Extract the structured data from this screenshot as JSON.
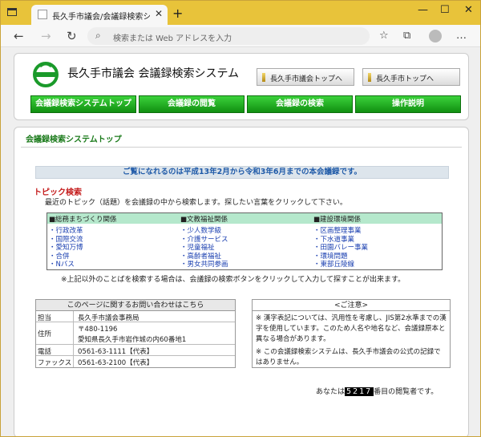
{
  "browser": {
    "tab_title": "長久手市議会/会議録検索システム",
    "tab_close": "✕",
    "new_tab": "+",
    "address_placeholder": "検索または Web アドレスを入力",
    "win_min": "—",
    "win_max": "☐",
    "win_close": "✕"
  },
  "header": {
    "site_title": "長久手市議会 会議録検索システム",
    "btn_council_top": "長久手市議会トップへ",
    "btn_city_top": "長久手市トップへ",
    "nav": [
      "会議録検索システムトップ",
      "会議録の閲覧",
      "会議録の検索",
      "操作説明"
    ]
  },
  "main": {
    "section_title": "会議録検索システムトップ",
    "banner": "ご覧になれるのは平成13年2月から令和3年6月までの本会議録です。",
    "topic_heading": "トピック検索",
    "topic_desc": "最近のトピック（話題）を会議録の中から検索します。探したい言葉をクリックして下さい。",
    "categories": [
      {
        "name": "■総務まちづくり関係",
        "items": [
          "・行政改革",
          "・国際交流",
          "・愛知万博",
          "・合併",
          "・Nバス"
        ]
      },
      {
        "name": "■文教福祉関係",
        "items": [
          "・少人数学級",
          "・介護サービス",
          "・児童福祉",
          "・高齢者福祉",
          "・男女共同参画"
        ]
      },
      {
        "name": "■建設環境関係",
        "items": [
          "・区画整理事業",
          "・下水道事業",
          "・田園バレー事業",
          "・環境問題",
          "・東部丘陵線"
        ]
      }
    ],
    "note": "※上記以外のことばを検索する場合は、会議録の検索ボタンをクリックして入力して探すことが出来ます。"
  },
  "contact": {
    "heading": "このページに関するお問い合わせはこちら",
    "rows": [
      {
        "key": "担当",
        "value": "長久手市議会事務局"
      },
      {
        "key": "住所",
        "value": "〒480-1196",
        "value2": "愛知県長久手市岩作城の内60番地1"
      },
      {
        "key": "電話",
        "value": "0561-63-1111【代表】"
      },
      {
        "key": "ファックス",
        "value": "0561-63-2100【代表】"
      }
    ]
  },
  "caution": {
    "heading": "<ご注意>",
    "lines": [
      "※ 漢字表記については、汎用性を考慮し、JIS第2水準までの漢字を使用しています。このため人名や地名など、会議録原本と異なる場合があります。",
      "※ この会議録検索システムは、長久手市議会の公式の記録ではありません。"
    ]
  },
  "counter": {
    "prefix": "あなたは",
    "value": "5217",
    "suffix": "番目の閲覧者です。"
  },
  "colors": {
    "nav_green": "#1fa81f",
    "title_green": "#1a7a1a",
    "banner_blue": "#1f5aa8",
    "topic_red": "#c41a1a",
    "link_blue": "#1a3fb0",
    "topic_header": "#b5e8cc"
  }
}
